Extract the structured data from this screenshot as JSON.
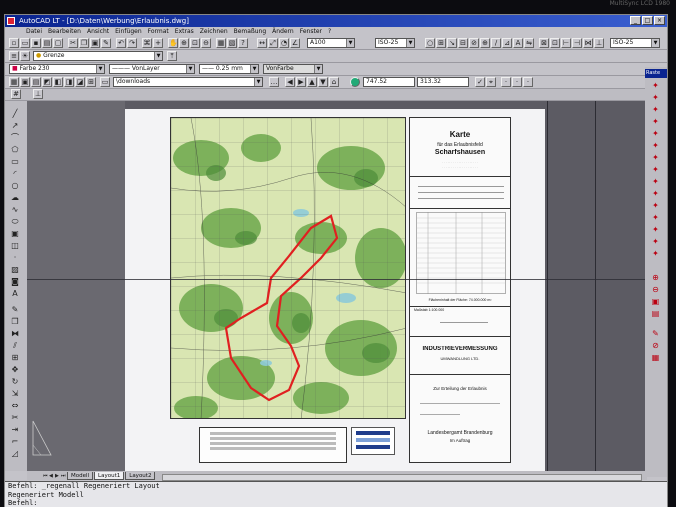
{
  "window": {
    "title": "AutoCAD LT - [D:\\Daten\\Werbung\\Erlaubnis.dwg]"
  },
  "menu": [
    "Datei",
    "Bearbeiten",
    "Ansicht",
    "Einfügen",
    "Format",
    "Extras",
    "Zeichnen",
    "Bemaßung",
    "Ändern",
    "Fenster",
    "?"
  ],
  "toolbar": {
    "dimstyle_text": "A100",
    "textstyle_text": "ISO-25",
    "textstyle_text2": "ISO-25",
    "layer_text": "Grenze",
    "color_text": "Farbe 230",
    "linetype_text": "VonLayer",
    "lineweight_text": "0.25 mm",
    "plotstyle_text": "VonFarbe",
    "folder_text": "\\downloads",
    "coord_x": "747.52",
    "coord_y": "313.32"
  },
  "palette": {
    "raster_label": "Raste"
  },
  "drawing_sheet": {
    "title": "Karte",
    "subtitle_line1": "für das Erlaubnisfeld",
    "field_name": "Scharfshausen",
    "company": "INDUSTRIEVERMESSUNG",
    "company_sub": "UMWANDLUNG LTD.",
    "scale": "Maßstab 1:100.000",
    "grant_text": "Zur Erteilung der Erlaubnis",
    "authority": "Landesbergamt Brandenburg",
    "authority_sub": "Im Auftrag",
    "area_note": "Flächeninhalt der Fläche: 74.000.000 m²"
  },
  "layout_tabs": {
    "tabs": [
      "Modell",
      "Layout1",
      "Layout2"
    ],
    "active_index": 1
  },
  "command_line": {
    "line1": "Befehl:  _regenall Regeneriert Layout",
    "line2": "Regeneriert Modell",
    "line3": "Befehl:"
  },
  "bezel": {
    "brand_text": "MultiSync LCD 1980"
  },
  "colors": {
    "title_bar": "#0a2490",
    "boundary_line": "#e02020",
    "map_green": "#7fb85a",
    "map_light": "#dfe9b8",
    "drawing_bg": "#5c5b63"
  }
}
